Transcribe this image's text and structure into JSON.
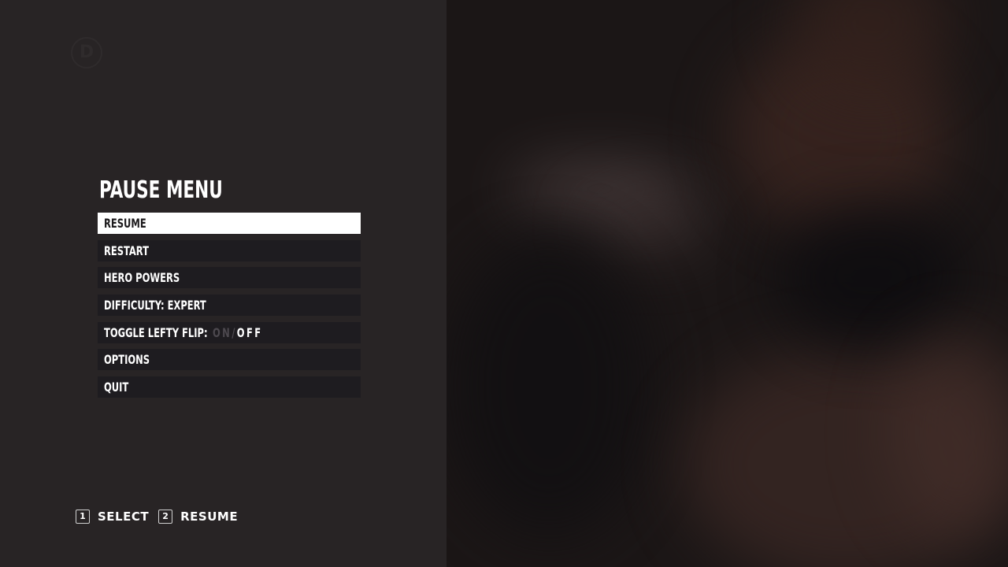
{
  "logo": {
    "letter": "D",
    "icon": "d-circle-logo-icon"
  },
  "pause_menu": {
    "title": "PAUSE MENU",
    "items": [
      {
        "label": "RESUME",
        "selected": true
      },
      {
        "label": "RESTART",
        "selected": false
      },
      {
        "label": "HERO POWERS",
        "selected": false
      },
      {
        "label": "DIFFICULTY: EXPERT",
        "selected": false
      },
      {
        "label": "TOGGLE LEFTY FLIP:",
        "selected": false,
        "toggle": {
          "on": "ON",
          "separator": "/",
          "off": "OFF",
          "active": "OFF"
        }
      },
      {
        "label": "OPTIONS",
        "selected": false
      },
      {
        "label": "QUIT",
        "selected": false
      }
    ]
  },
  "controls": [
    {
      "key": "1",
      "label": "SELECT"
    },
    {
      "key": "2",
      "label": "RESUME"
    }
  ],
  "colors": {
    "panel": "#282425",
    "item_bg": "#1e1c20",
    "selected_bg": "#ffffff",
    "text": "#ffffff",
    "inactive_option": "#4d494f"
  }
}
